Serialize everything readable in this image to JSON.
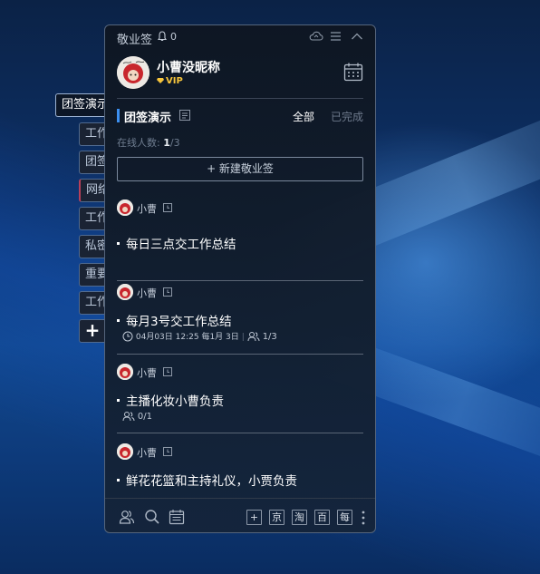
{
  "side_tabs": [
    {
      "label": "团签演示",
      "active": true
    },
    {
      "label": "工作",
      "active": false
    },
    {
      "label": "团签",
      "active": false
    },
    {
      "label": "网络",
      "active": false
    },
    {
      "label": "工作",
      "active": false
    },
    {
      "label": "私密",
      "active": false
    },
    {
      "label": "重要",
      "active": false
    },
    {
      "label": "工作",
      "active": false
    }
  ],
  "add_tab_label": "+",
  "titlebar": {
    "app_name": "敬业签",
    "bell_count": "0"
  },
  "profile": {
    "nickname": "小曹没昵称",
    "vip_label": "VIP"
  },
  "group": {
    "name": "团签演示",
    "filter_all": "全部",
    "filter_done": "已完成"
  },
  "online": {
    "label": "在线人数:",
    "count": "1",
    "total": "/3"
  },
  "new_button": "+ 新建敬业签",
  "items": [
    {
      "author": "小曹",
      "text": "每日三点交工作总结"
    },
    {
      "author": "小曹",
      "text": "每月3号交工作总结",
      "reminder": "04月03日 12:25 每1月 3日",
      "assigned": "1/3"
    },
    {
      "author": "小曹",
      "text": "主播化妆小曹负责",
      "assigned": "0/1"
    },
    {
      "author": "小曹",
      "text": "鲜花花篮和主持礼仪，小贾负责"
    }
  ],
  "quick_buttons": [
    "+",
    "京",
    "淘",
    "百",
    "每"
  ],
  "colors": {
    "accent": "#3c8ff0",
    "vip": "#f6c43c",
    "window_bg": "#0e1622"
  }
}
